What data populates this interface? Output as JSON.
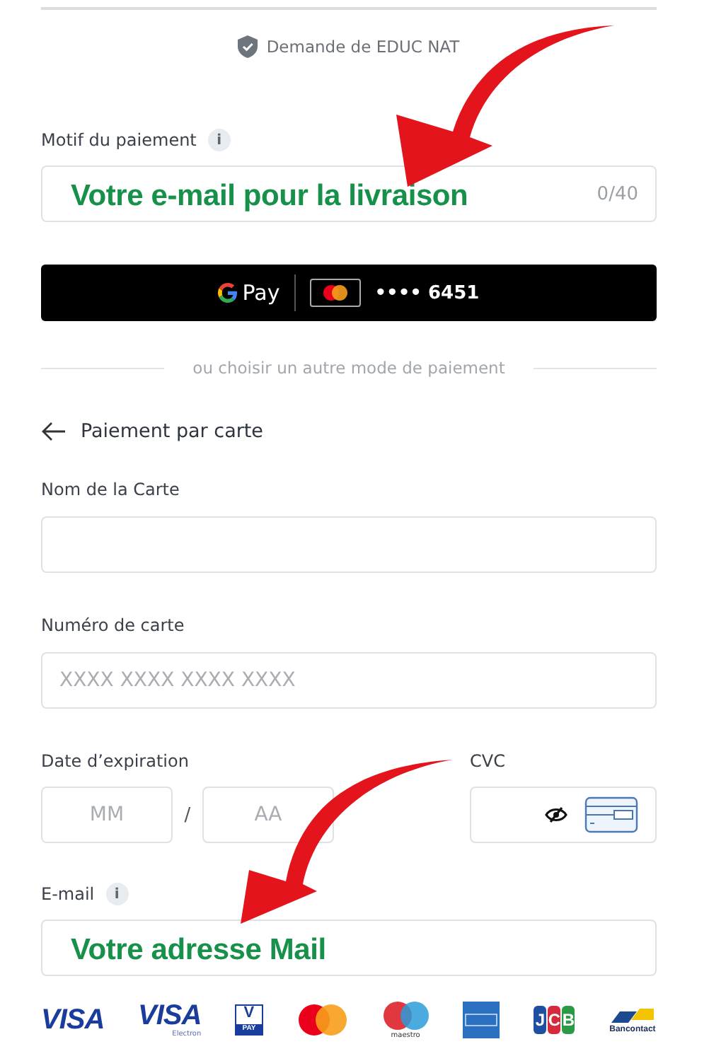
{
  "header": {
    "requester": "Demande de EDUC NAT"
  },
  "reason_field": {
    "label": "Motif du paiement",
    "info_icon": "i",
    "annotation": "Votre e-mail pour la livraison",
    "counter": "0/40"
  },
  "gpay_button": {
    "wallet": "Pay",
    "card_number": "•••• 6451"
  },
  "separator": "ou choisir un autre mode de paiement",
  "section_title": "Paiement par carte",
  "fields": [
    {
      "label": "Nom de la Carte"
    },
    {
      "label": "Numéro de carte",
      "placeholder": "XXXX XXXX XXXX XXXX"
    }
  ],
  "expiry": {
    "label": "Date d’expiration",
    "month_placeholder": "MM",
    "separator": "/",
    "year_placeholder": "AA"
  },
  "cvc": {
    "label": "CVC"
  },
  "email_field": {
    "label": "E-mail",
    "info_icon": "i",
    "annotation": "Votre adresse Mail"
  },
  "card_brands": [
    {
      "kind": "visa",
      "label": "VISA"
    },
    {
      "kind": "visa-electron",
      "label": "VISA",
      "sub": "Electron"
    },
    {
      "kind": "vpay",
      "label": "V",
      "sub": "PAY"
    },
    {
      "kind": "mastercard"
    },
    {
      "kind": "maestro",
      "sub": "maestro"
    },
    {
      "kind": "amex"
    },
    {
      "kind": "jcb",
      "label": "JCB"
    },
    {
      "kind": "bancontact",
      "sub": "Bancontact"
    }
  ]
}
